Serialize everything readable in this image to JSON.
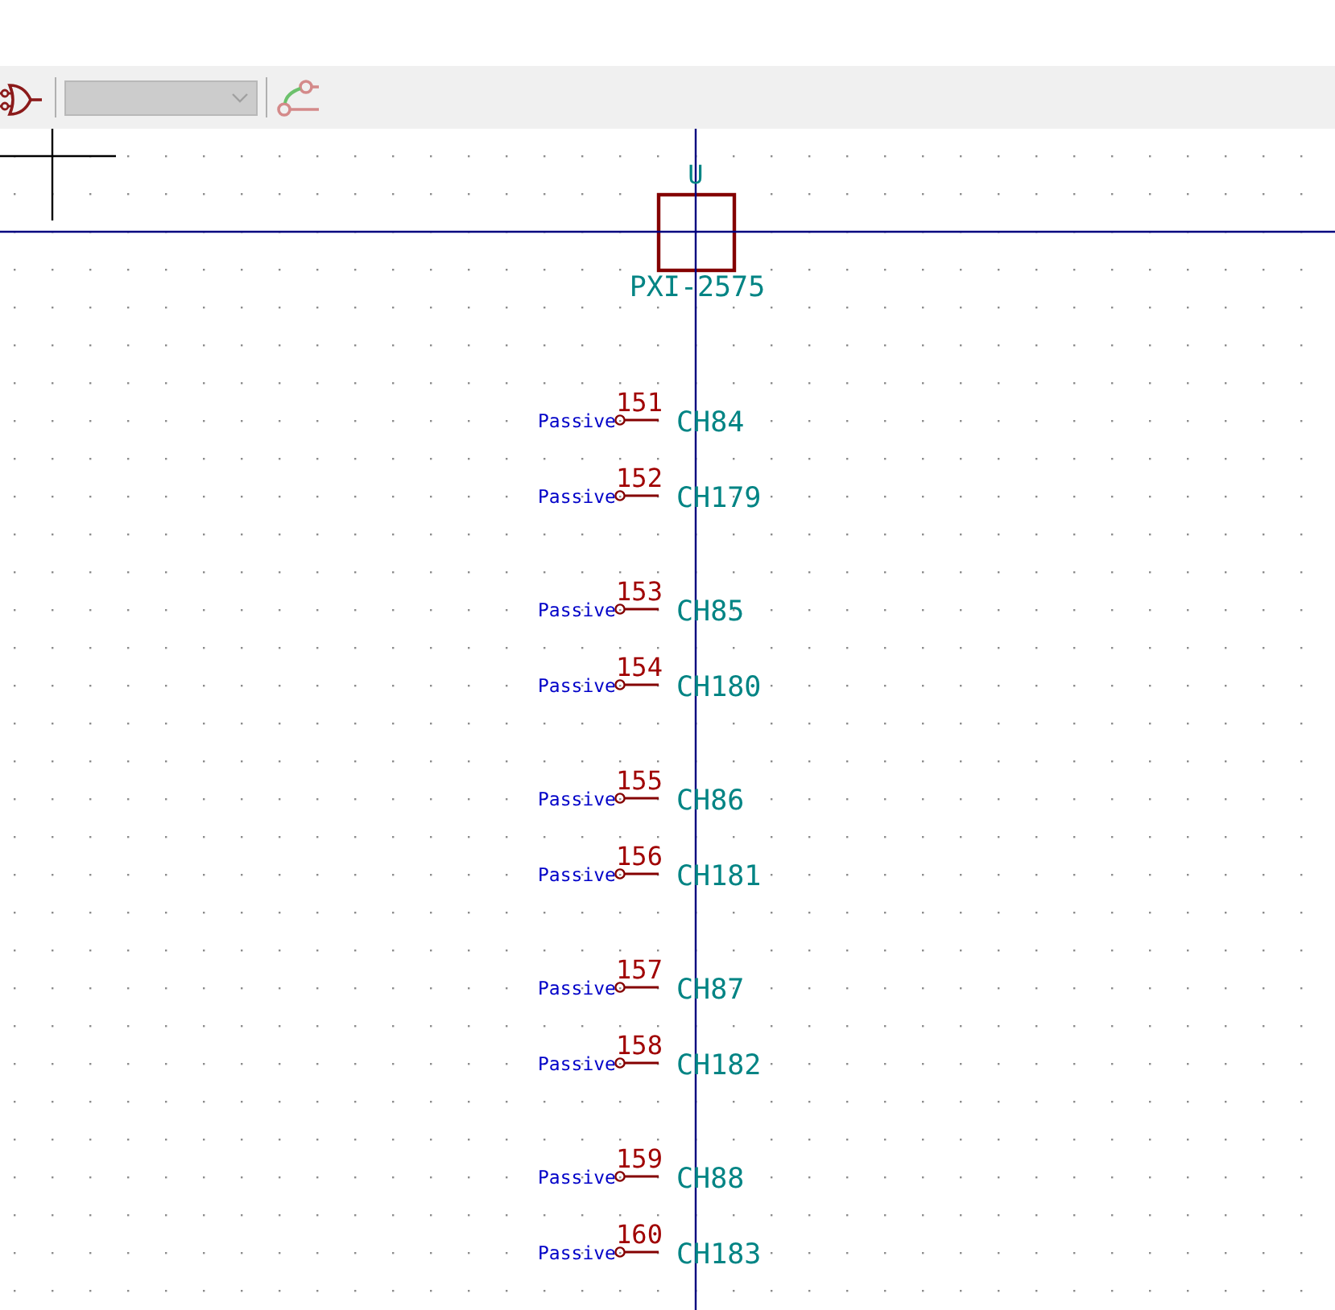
{
  "toolbar": {
    "unit_selector": {
      "disabled": true
    }
  },
  "symbol": {
    "reference": "U",
    "value": "PXI-2575",
    "pins": [
      {
        "number": "151",
        "name": "CH84",
        "type": "Passive"
      },
      {
        "number": "152",
        "name": "CH179",
        "type": "Passive"
      },
      {
        "number": "153",
        "name": "CH85",
        "type": "Passive"
      },
      {
        "number": "154",
        "name": "CH180",
        "type": "Passive"
      },
      {
        "number": "155",
        "name": "CH86",
        "type": "Passive"
      },
      {
        "number": "156",
        "name": "CH181",
        "type": "Passive"
      },
      {
        "number": "157",
        "name": "CH87",
        "type": "Passive"
      },
      {
        "number": "158",
        "name": "CH182",
        "type": "Passive"
      },
      {
        "number": "159",
        "name": "CH88",
        "type": "Passive"
      },
      {
        "number": "160",
        "name": "CH183",
        "type": "Passive"
      }
    ]
  }
}
